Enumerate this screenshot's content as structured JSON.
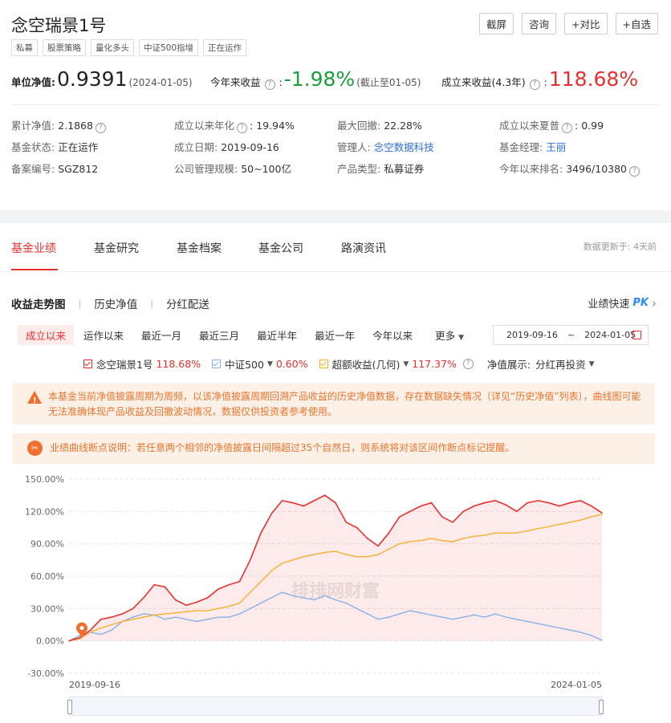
{
  "fund": {
    "name": "念空瑞景1号",
    "tags": [
      "私募",
      "股票策略",
      "量化多头",
      "中证500指增",
      "正在运作"
    ]
  },
  "top_buttons": [
    "截屏",
    "咨询",
    "+对比",
    "+自选"
  ],
  "nav": {
    "unit_label": "单位净值:",
    "unit_value": "0.9391",
    "unit_date": "(2024-01-05)",
    "ytd_label": "今年来收益",
    "ytd_value": "-1.98%",
    "ytd_note": "(截止至01-05)",
    "since_label": "成立来收益(4.3年)",
    "since_value": "118.68%",
    "colon": ":"
  },
  "info": [
    [
      {
        "k": "累计净值:",
        "v": "2.1868",
        "help": true
      },
      {
        "k": "成立以来年化",
        "v": "19.94%",
        "help": true
      },
      {
        "k": "最大回撤:",
        "v": "22.28%"
      },
      {
        "k": "成立以来夏普",
        "v": "0.99",
        "help": true
      }
    ],
    [
      {
        "k": "基金状态:",
        "v": "正在运作"
      },
      {
        "k": "成立日期:",
        "v": "2019-09-16"
      },
      {
        "k": "管理人:",
        "v": "念空数据科技",
        "link": true
      },
      {
        "k": "基金经理:",
        "v": "王丽",
        "link": true
      }
    ],
    [
      {
        "k": "备案编号:",
        "v": "SGZ812"
      },
      {
        "k": "公司管理规模:",
        "v": "50~100亿"
      },
      {
        "k": "产品类型:",
        "v": "私募证券"
      },
      {
        "k": "今年以来排名:",
        "v": "3496/10380",
        "help": true
      }
    ]
  ],
  "tabs": [
    "基金业绩",
    "基金研究",
    "基金档案",
    "基金公司",
    "路演资讯"
  ],
  "update_text": "数据更新于: 4天前",
  "subtabs": [
    "收益走势图",
    "历史净值",
    "分红配送"
  ],
  "quick": {
    "label": "业绩快速",
    "pk": "PK",
    "arrow": "›"
  },
  "ranges": [
    "成立以来",
    "运作以来",
    "最近一月",
    "最近三月",
    "最近半年",
    "最近一年",
    "今年以来",
    "更多"
  ],
  "date_range": {
    "start": "2019-09-16",
    "tilde": "~",
    "end": "2024-01-05"
  },
  "legend": {
    "items": [
      {
        "name": "念空瑞景1号",
        "value": "118.68%",
        "color": "#e93030",
        "dropdown": false
      },
      {
        "name": "中证500",
        "value": "0.60%",
        "color": "#8ab2e8",
        "dropdown": true
      },
      {
        "name": "超额收益(几何)",
        "value": "117.37%",
        "color": "#f5b02e",
        "dropdown": true
      }
    ],
    "display_label": "净值展示:",
    "display_value": "分红再投资"
  },
  "notices": {
    "warning": "本基金当前净值披露周期为周频，以该净值披露周期回溯产品收益的历史净值数据，存在数据缺失情况（详见“历史净值”列表），曲线图可能无法准确体现产品收益及回撤波动情况，数据仅供投资者参考使用。",
    "break": "业绩曲线断点说明：若任意两个相邻的净值披露日间隔超过35个自然日，则系统将对该区间作断点标记提醒。"
  },
  "watermark": "排排网财富",
  "colors": {
    "accent": "#e93030",
    "green": "#1a9f3a",
    "orange": "#e8742d",
    "link": "#2e6cd6"
  },
  "chart_data": {
    "type": "line",
    "ylim": [
      -30,
      150
    ],
    "yticks": [
      "150.00%",
      "120.00%",
      "90.00%",
      "60.00%",
      "30.00%",
      "0.00%",
      "-30.00%"
    ],
    "xticks": [
      "2019-09-16",
      "2024-01-05"
    ],
    "x": [
      0,
      2,
      4,
      6,
      8,
      10,
      12,
      14,
      16,
      18,
      20,
      22,
      24,
      26,
      28,
      30,
      32,
      34,
      36,
      38,
      40,
      42,
      44,
      46,
      48,
      50,
      52,
      54,
      56,
      58,
      60,
      62,
      64,
      66,
      68,
      70,
      72,
      74,
      76,
      78,
      80,
      82,
      84,
      86,
      88,
      90,
      92,
      94,
      96,
      98,
      100
    ],
    "series": [
      {
        "name": "念空瑞景1号",
        "color": "#e93030",
        "values": [
          0,
          3,
          10,
          20,
          22,
          25,
          30,
          40,
          52,
          50,
          38,
          33,
          36,
          40,
          48,
          52,
          55,
          75,
          100,
          118,
          130,
          128,
          125,
          130,
          135,
          128,
          110,
          105,
          95,
          88,
          100,
          115,
          120,
          125,
          128,
          115,
          110,
          120,
          125,
          128,
          130,
          126,
          120,
          128,
          130,
          128,
          125,
          128,
          130,
          125,
          118.68
        ]
      },
      {
        "name": "中证500",
        "color": "#8ab2e8",
        "values": [
          0,
          5,
          8,
          6,
          10,
          18,
          22,
          25,
          24,
          20,
          22,
          20,
          18,
          20,
          22,
          22,
          25,
          30,
          35,
          40,
          45,
          42,
          40,
          38,
          42,
          38,
          35,
          30,
          25,
          20,
          22,
          25,
          28,
          26,
          24,
          22,
          20,
          22,
          24,
          22,
          25,
          22,
          20,
          18,
          16,
          14,
          12,
          10,
          8,
          5,
          0.6
        ]
      },
      {
        "name": "超额收益(几何)",
        "color": "#f5b02e",
        "values": [
          0,
          2,
          8,
          12,
          15,
          18,
          20,
          22,
          24,
          25,
          26,
          27,
          28,
          28,
          30,
          32,
          35,
          45,
          55,
          65,
          72,
          75,
          78,
          80,
          82,
          83,
          80,
          78,
          78,
          80,
          85,
          90,
          92,
          93,
          95,
          93,
          92,
          95,
          97,
          98,
          100,
          100,
          100,
          102,
          104,
          106,
          108,
          110,
          112,
          115,
          117.37
        ]
      }
    ]
  }
}
